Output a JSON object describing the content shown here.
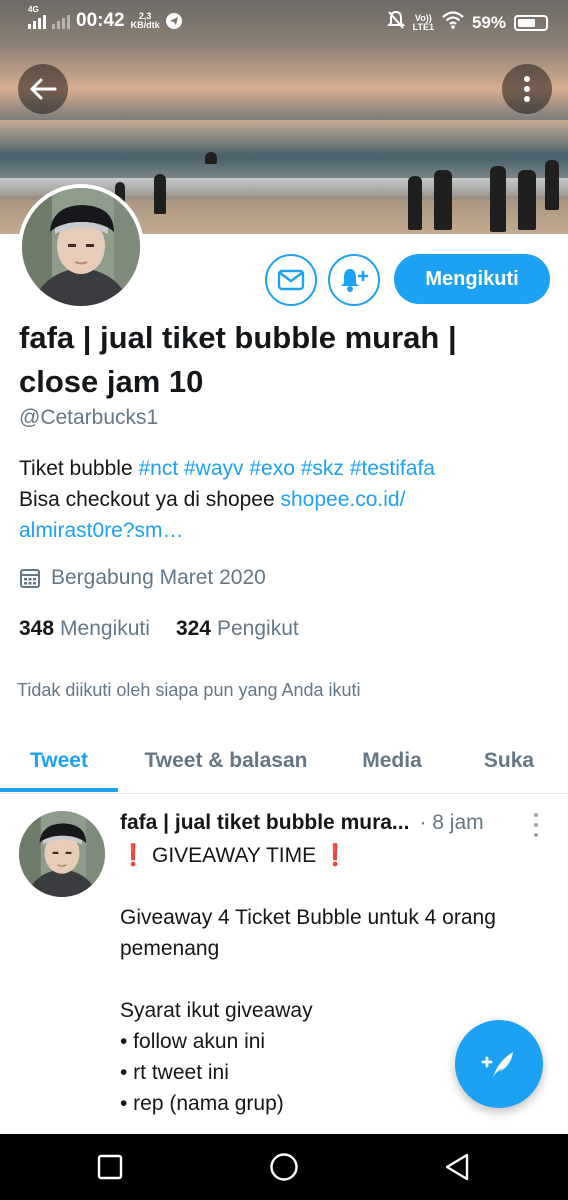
{
  "status_bar": {
    "network": "4G",
    "time": "00:42",
    "speed_value": "2,3",
    "speed_unit": "KB/dtk",
    "volte_top": "Vo))",
    "volte_bottom": "LTE1",
    "battery_percent": "59%"
  },
  "header": {
    "back_icon": "arrow-left-icon",
    "more_icon": "more-vertical-icon"
  },
  "profile": {
    "display_name": "fafa | jual tiket bubble murah | close jam 10",
    "handle": "@Cetarbucks1",
    "bio_line1_text": "Tiket bubble ",
    "bio_hashtags": "#nct #wayv #exo #skz  #testifafa",
    "bio_line2_text": "Bisa checkout ya di shopee ",
    "bio_link_part1": "shopee.co.id/",
    "bio_link_part2": "almirast0re?sm…",
    "joined": "Bergabung Maret 2020",
    "following_count": "348",
    "following_label": "Mengikuti",
    "followers_count": "324",
    "followers_label": "Pengikut",
    "not_followed_text": "Tidak diikuti oleh siapa pun yang Anda ikuti",
    "follow_button_label": "Mengikuti"
  },
  "tabs": [
    {
      "label": "Tweet",
      "active": true
    },
    {
      "label": "Tweet & balasan",
      "active": false
    },
    {
      "label": "Media",
      "active": false
    },
    {
      "label": "Suka",
      "active": false
    }
  ],
  "tweet": {
    "author": "fafa | jual tiket bubble mura...",
    "time": "· 8 jam",
    "headline": "GIVEAWAY TIME",
    "headline_mark": "❗",
    "line_2": "Giveaway 4 Ticket Bubble untuk 4 orang pemenang",
    "line_3": "Syarat ikut giveaway",
    "bullet_1": "• follow akun ini",
    "bullet_2": "• rt tweet ini",
    "bullet_3": "• rep (nama grup)"
  },
  "colors": {
    "accent": "#1da1f2",
    "text_primary": "#14171a",
    "text_secondary": "#657786",
    "alert_red": "#e0303a"
  }
}
